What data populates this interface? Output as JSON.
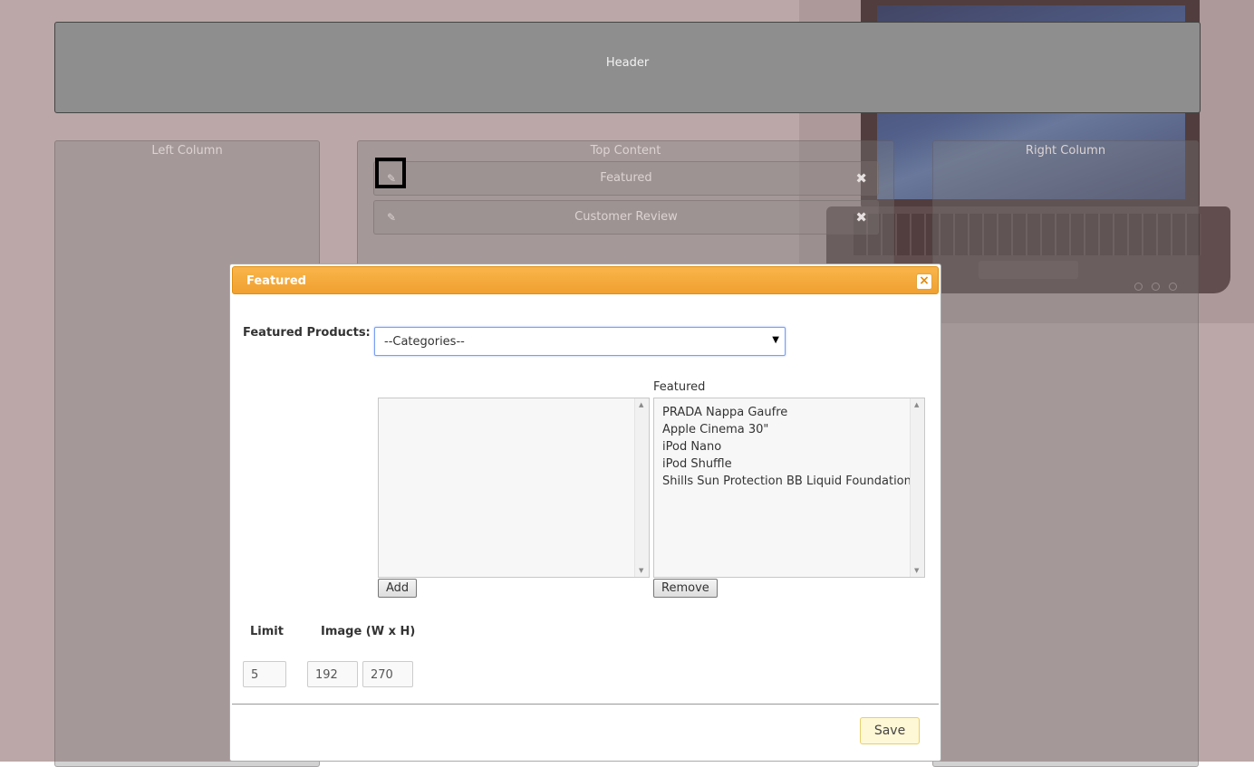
{
  "layout_editor": {
    "header_label": "Header",
    "left_column_label": "Left Column",
    "top_content_label": "Top Content",
    "right_column_label": "Right Column",
    "modules": [
      {
        "label": "Featured"
      },
      {
        "label": "Customer Review"
      }
    ]
  },
  "icons": {
    "edit": "edit-icon",
    "close": "close-icon"
  },
  "modal": {
    "title": "Featured",
    "close_symbol": "×",
    "featured_products_label": "Featured Products:",
    "category_select_value": "--Categories--",
    "featured_list_caption": "Featured",
    "available_items": [],
    "featured_items": [
      "PRADA Nappa Gaufre",
      "Apple Cinema 30\"",
      "iPod Nano",
      "iPod Shuffle",
      "Shills Sun Protection BB Liquid Foundation"
    ],
    "add_button": "Add",
    "remove_button": "Remove",
    "limit_label": "Limit",
    "image_label": "Image (W x H)",
    "limit_value": "5",
    "image_width": "192",
    "image_height": "270",
    "save_button": "Save"
  },
  "colors": {
    "modal_title_bar": "#f0a030",
    "overlay": "#785050",
    "save_button_bg": "#fff8d6"
  }
}
